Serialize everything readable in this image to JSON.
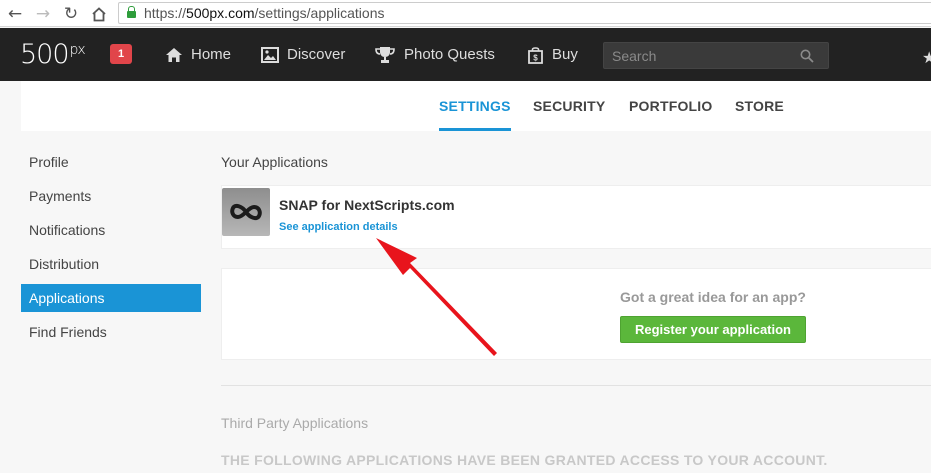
{
  "browser": {
    "url_scheme": "https://",
    "url_host": "500px.com",
    "url_path": "/settings/applications"
  },
  "brand": {
    "logo_text": "500",
    "logo_sup": "px",
    "notification_count": "1"
  },
  "nav": {
    "home": "Home",
    "discover": "Discover",
    "quests": "Photo Quests",
    "buy": "Buy",
    "search_placeholder": "Search"
  },
  "tabs": [
    "SETTINGS",
    "SECURITY",
    "PORTFOLIO",
    "STORE"
  ],
  "sidebar": {
    "items": [
      "Profile",
      "Payments",
      "Notifications",
      "Distribution",
      "Applications",
      "Find Friends"
    ],
    "active": "Applications"
  },
  "main": {
    "your_apps_title": "Your Applications",
    "app": {
      "name": "SNAP for NextScripts.com",
      "details_link": "See application details"
    },
    "register": {
      "question": "Got a great idea for an app?",
      "button": "Register your application"
    },
    "third_party_title": "Third Party Applications",
    "third_party_desc": "THE FOLLOWING APPLICATIONS HAVE BEEN GRANTED ACCESS TO YOUR ACCOUNT."
  },
  "colors": {
    "accent": "#1a94d6",
    "register_green": "#5bb73b",
    "annotation_arrow": "#e8141c",
    "topbar": "#222222"
  }
}
